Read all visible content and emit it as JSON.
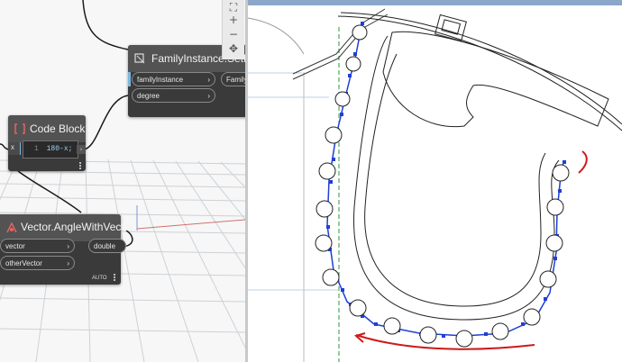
{
  "nodes": {
    "setrotation": {
      "title": "FamilyInstance.SetRot",
      "inputs": [
        "familyInstance",
        "degree"
      ],
      "output": "Family"
    },
    "codeblock": {
      "title": "Code Block",
      "input": "x",
      "line_number": "1",
      "code": "180-x;"
    },
    "anglewithvector": {
      "title": "Vector.AngleWithVector",
      "inputs": [
        "vector",
        "otherVector"
      ],
      "output": "double",
      "lacing": "AUTO"
    }
  },
  "colors": {
    "wire": "#1a1a1a",
    "grid": "#cdd1d6",
    "node_body": "#3a3a3a",
    "node_header": "#535353",
    "path_blue": "#1f3fd6",
    "annotation_red": "#cc1a1a",
    "guide_green": "#2a9a3a"
  },
  "icons": [
    "fit-view-icon",
    "zoom-in-icon",
    "zoom-out-icon",
    "pan-icon"
  ]
}
